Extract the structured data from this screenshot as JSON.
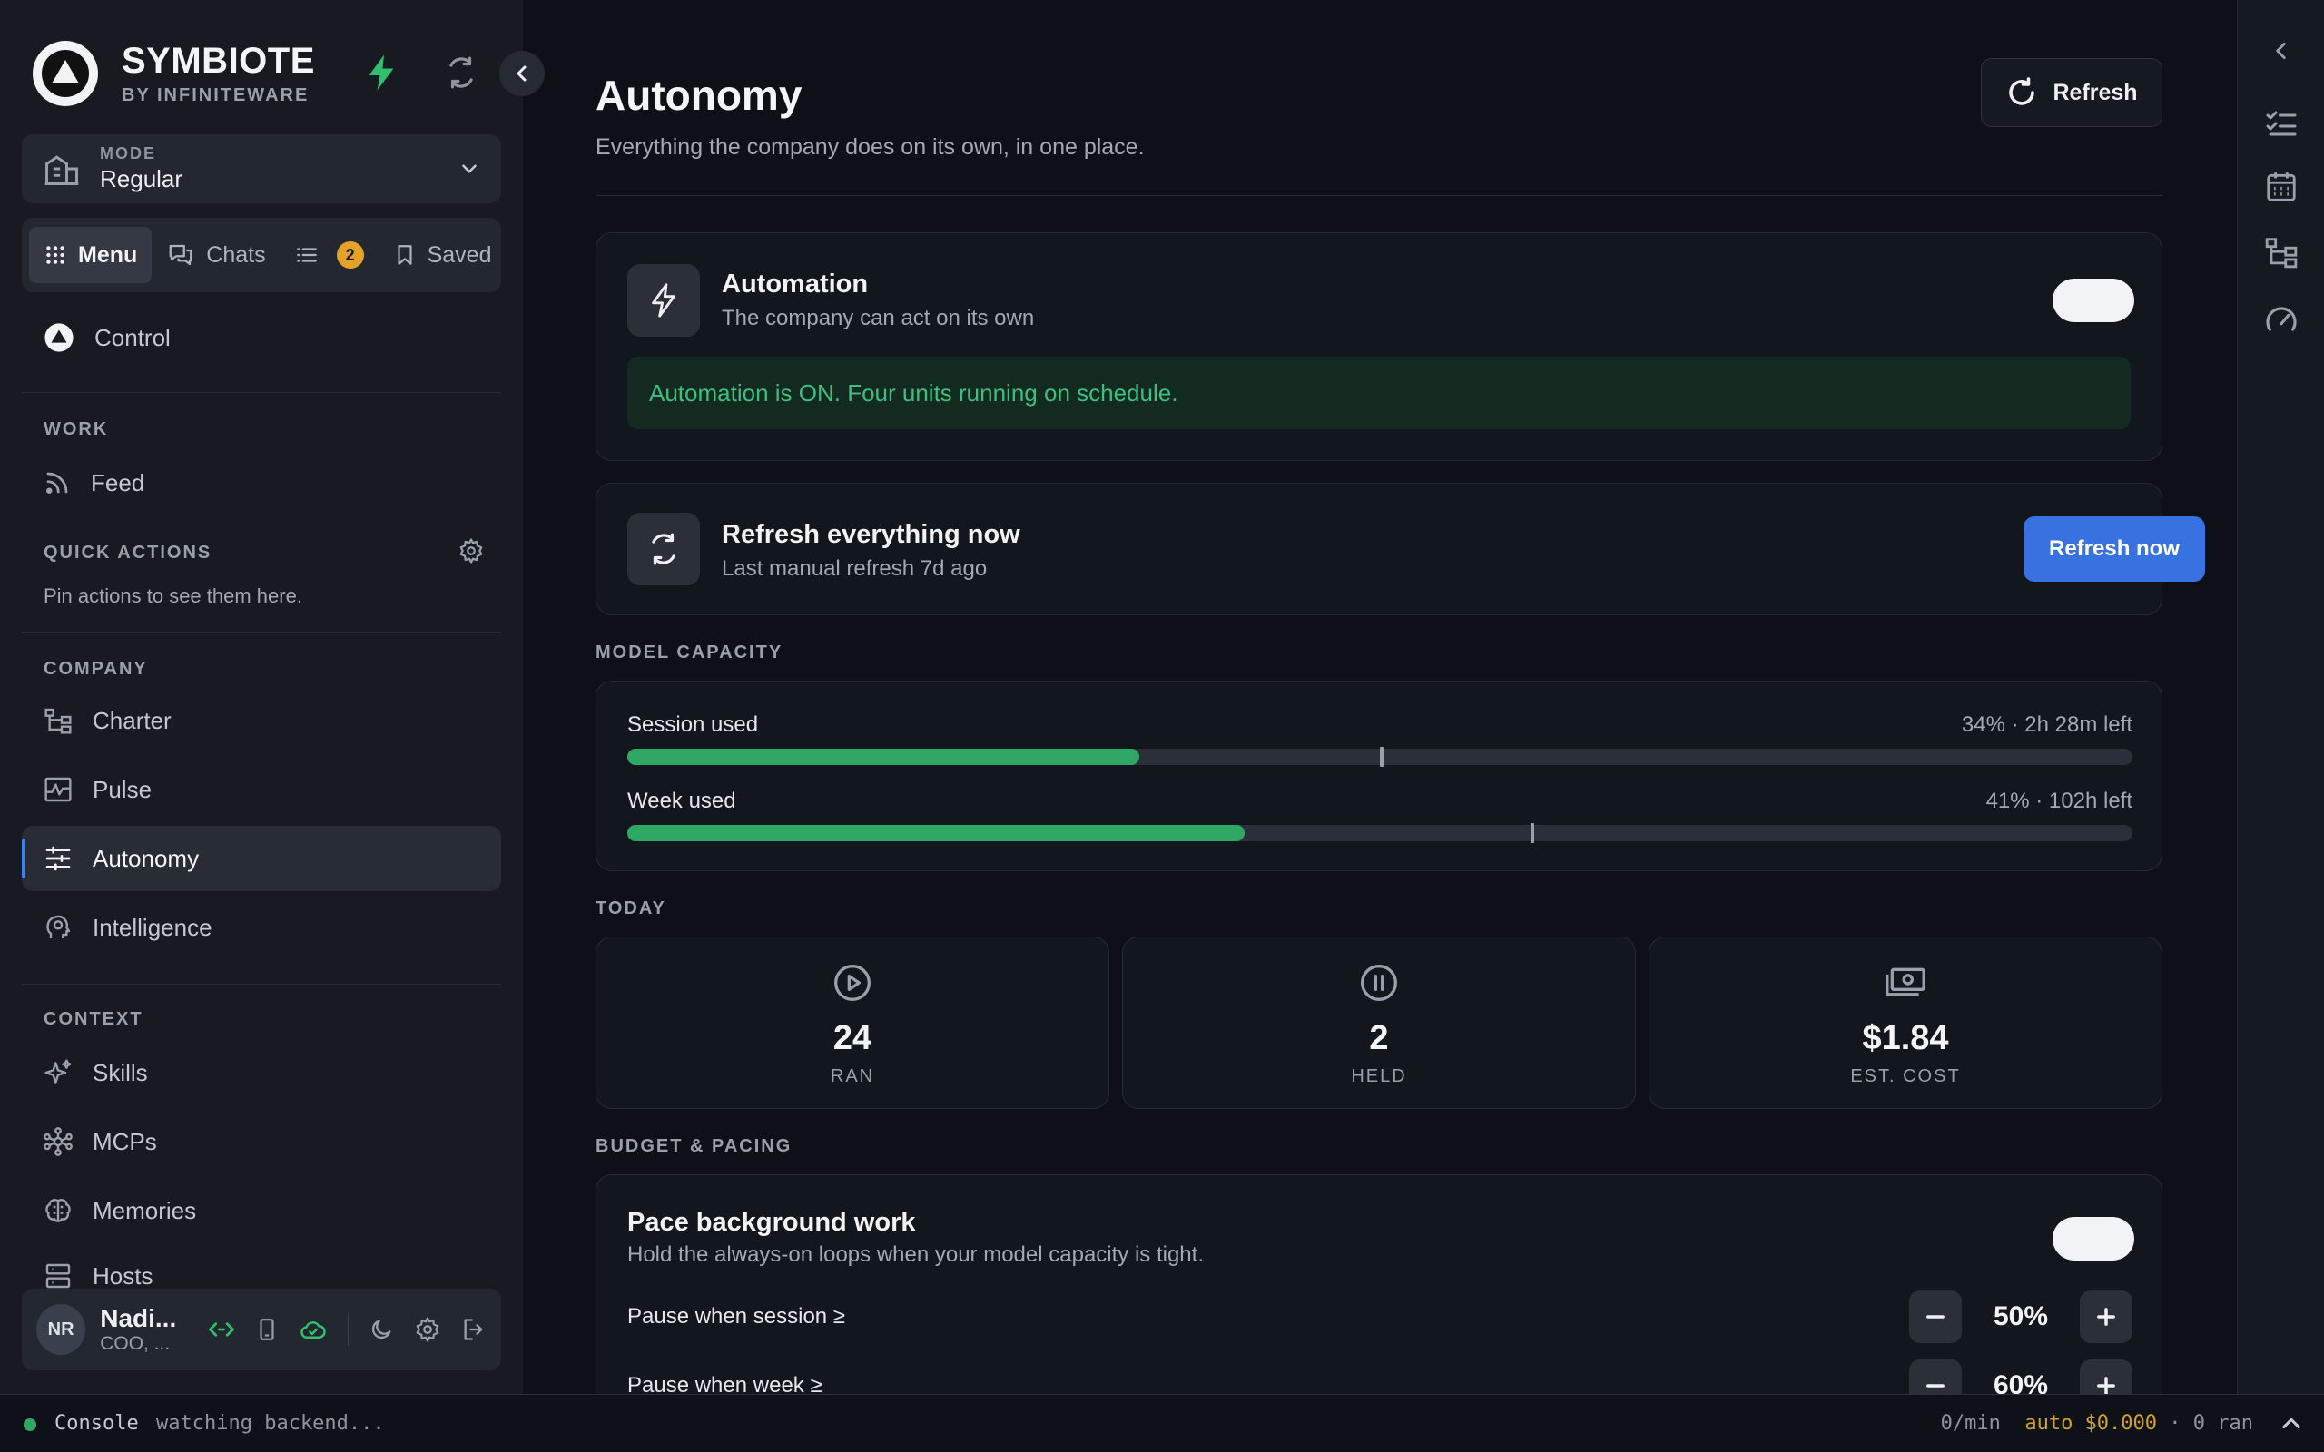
{
  "brand": {
    "name": "SYMBIOTE",
    "subtitle": "BY INFINITEWARE"
  },
  "mode": {
    "label": "MODE",
    "value": "Regular"
  },
  "tabs": [
    {
      "label": "Menu"
    },
    {
      "label": "Chats"
    },
    {
      "label": "",
      "badge": "2"
    },
    {
      "label": "Saved"
    }
  ],
  "sidebar": {
    "control": "Control",
    "work_label": "WORK",
    "feed": "Feed",
    "quick_actions_label": "QUICK ACTIONS",
    "quick_actions_hint": "Pin actions to see them here.",
    "company_label": "COMPANY",
    "charter": "Charter",
    "pulse": "Pulse",
    "autonomy": "Autonomy",
    "intelligence": "Intelligence",
    "context_label": "CONTEXT",
    "skills": "Skills",
    "mcps": "MCPs",
    "memories": "Memories",
    "hosts": "Hosts"
  },
  "user": {
    "initials": "NR",
    "name": "Nadi...",
    "role": "COO, ..."
  },
  "page": {
    "title": "Autonomy",
    "subtitle": "Everything the company does on its own, in one place.",
    "refresh_label": "Refresh"
  },
  "automation": {
    "title": "Automation",
    "subtitle": "The company can act on its own",
    "enabled": true,
    "status": "Automation is ON. Four units running on schedule."
  },
  "refresh_all": {
    "title": "Refresh everything now",
    "subtitle": "Last manual refresh 7d ago",
    "button": "Refresh now"
  },
  "capacity": {
    "label": "MODEL CAPACITY",
    "session": {
      "label": "Session used",
      "value": "34% · 2h 28m left",
      "percent": 34,
      "marker_percent": 50
    },
    "week": {
      "label": "Week used",
      "value": "41% · 102h left",
      "percent": 41,
      "marker_percent": 60
    }
  },
  "today": {
    "label": "TODAY",
    "stats": [
      {
        "icon": "play-circle-icon",
        "value": "24",
        "label": "RAN"
      },
      {
        "icon": "pause-circle-icon",
        "value": "2",
        "label": "HELD"
      },
      {
        "icon": "money-icon",
        "value": "$1.84",
        "label": "EST. COST"
      }
    ]
  },
  "budget": {
    "label": "BUDGET & PACING",
    "title": "Pace background work",
    "subtitle": "Hold the always-on loops when your model capacity is tight.",
    "enabled": true,
    "session_row": {
      "label": "Pause when session ≥",
      "value": "50%"
    },
    "week_row": {
      "label": "Pause when week ≥",
      "value": "60%"
    }
  },
  "console": {
    "title": "Console",
    "message": "watching backend...",
    "rate": "0/min",
    "auto": "auto $0.000",
    "ran": "· 0 ran"
  },
  "colors": {
    "accent_green": "#2fa866",
    "accent_blue": "#3871e0",
    "badge_amber": "#e4a22a",
    "status_green": "#3fbf7f"
  }
}
